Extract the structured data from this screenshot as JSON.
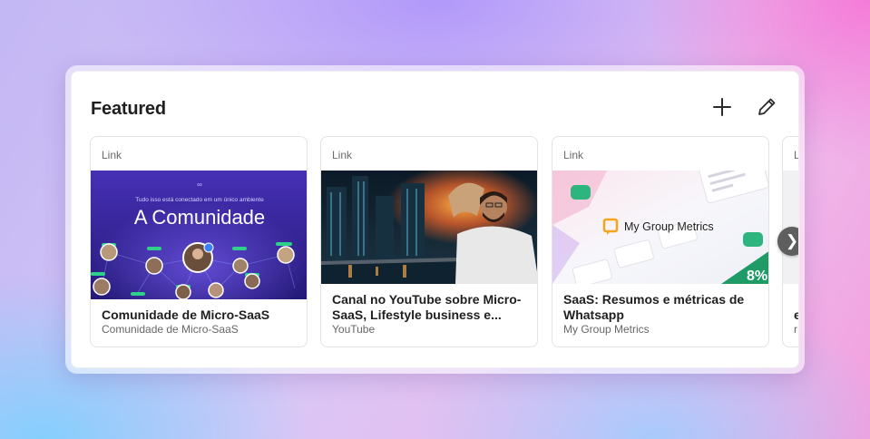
{
  "featured": {
    "title": "Featured",
    "actions": {
      "add_icon": "plus-icon",
      "edit_icon": "pencil-icon"
    },
    "cards": [
      {
        "type": "Link",
        "title": "Comunidade de Micro-SaaS",
        "source": "Comunidade de Micro-SaaS",
        "thumb": {
          "tagline": "Tudo isso está conectado em um único ambiente",
          "headline": "A Comunidade"
        }
      },
      {
        "type": "Link",
        "title": "Canal no YouTube sobre Micro-SaaS, Lifestyle business e...",
        "source": "YouTube"
      },
      {
        "type": "Link",
        "title": "SaaS: Resumos e métricas de Whatsapp",
        "source": "My Group Metrics",
        "thumb": {
          "brand": "My Group Metrics"
        }
      },
      {
        "type": "L",
        "title": "e",
        "source": "r"
      }
    ],
    "next_label": "❯"
  },
  "colors": {
    "card_title": "#1f1f1f",
    "community_bg": "#3b2ba0",
    "metrics_accent": "#f4a51c",
    "metrics_green": "#1aa36b"
  }
}
